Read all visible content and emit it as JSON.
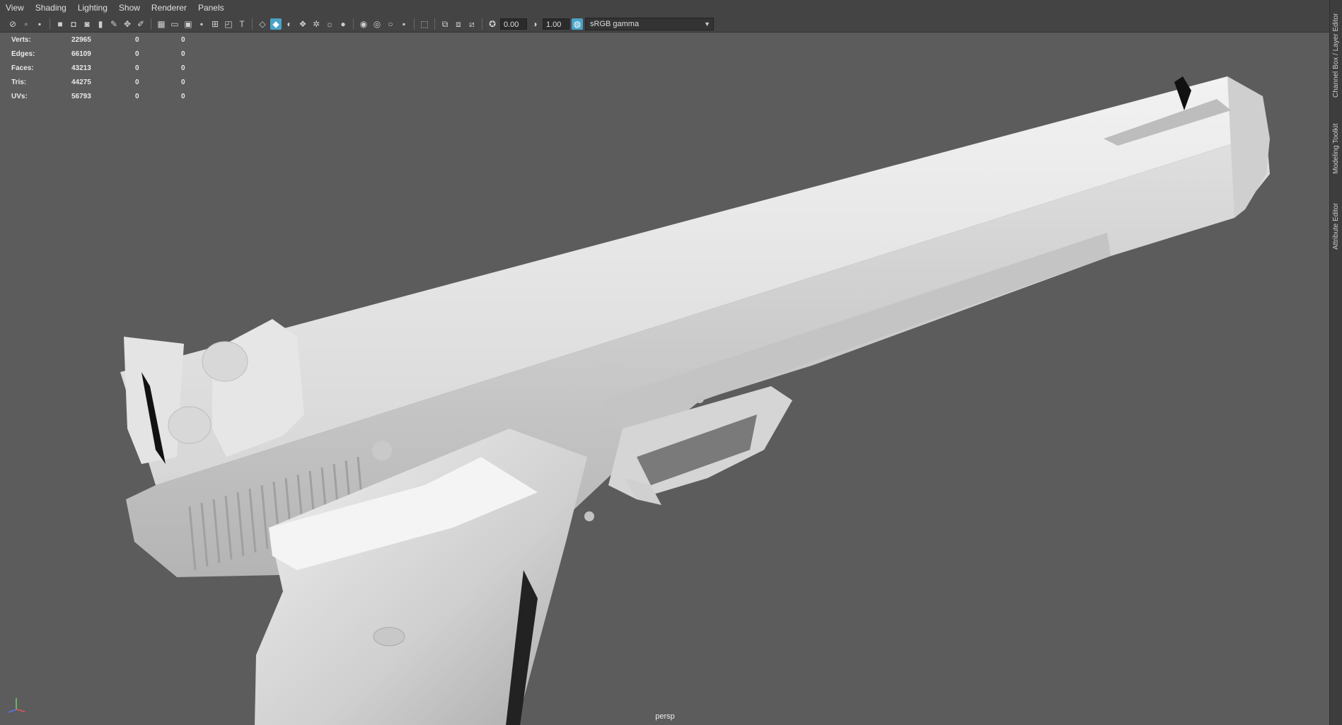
{
  "menu": [
    "View",
    "Shading",
    "Lighting",
    "Show",
    "Renderer",
    "Panels"
  ],
  "toolbar": {
    "exposure_value": "0.00",
    "gamma_value": "1.00",
    "color_space": "sRGB gamma"
  },
  "hud": {
    "rows": [
      {
        "label": "Verts:",
        "value": "22965",
        "sel": "0",
        "uv": "0"
      },
      {
        "label": "Edges:",
        "value": "66109",
        "sel": "0",
        "uv": "0"
      },
      {
        "label": "Faces:",
        "value": "43213",
        "sel": "0",
        "uv": "0"
      },
      {
        "label": "Tris:",
        "value": "44275",
        "sel": "0",
        "uv": "0"
      },
      {
        "label": "UVs:",
        "value": "56793",
        "sel": "0",
        "uv": "0"
      }
    ]
  },
  "camera_label": "persp",
  "side_tabs": [
    "Channel Box / Layer Editor",
    "Modeling Toolkit",
    "Attribute Editor"
  ],
  "colors": {
    "viewport_bg": "#5c5c5c",
    "model": "#e2e2e2",
    "accent": "#4aa3c8"
  }
}
